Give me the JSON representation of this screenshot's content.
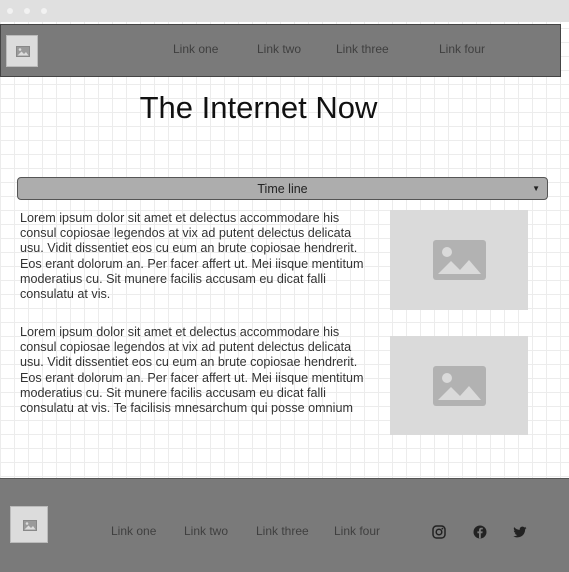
{
  "window": {
    "controls": [
      "close",
      "minimize",
      "maximize"
    ]
  },
  "header": {
    "logo_icon": "image-icon",
    "nav": [
      "Link one",
      "Link two",
      "Link three",
      "Link four"
    ]
  },
  "main": {
    "title": "The Internet Now",
    "dropdown": {
      "selected": "Time line",
      "icon": "caret-down-icon"
    },
    "paragraphs": [
      "Lorem ipsum dolor sit amet et delectus accommodare his consul copiosae legendos at vix ad putent delectus delicata usu. Vidit dissentiet eos cu eum an brute copiosae hendrerit. Eos erant dolorum an. Per facer affert ut. Mei iisque mentitum moderatius cu. Sit munere facilis accusam eu dicat falli consulatu at vis.",
      "Lorem ipsum dolor sit amet et delectus accommodare his consul copiosae legendos at vix ad putent delectus delicata usu. Vidit dissentiet eos cu eum an brute copiosae hendrerit. Eos erant dolorum an. Per facer affert ut. Mei iisque mentitum moderatius cu. Sit munere facilis accusam eu dicat falli consulatu at vis. Te facilisis mnesarchum qui posse omnium"
    ],
    "image_icons": [
      "image-placeholder-icon",
      "image-placeholder-icon"
    ]
  },
  "footer": {
    "logo_icon": "image-icon",
    "nav": [
      "Link one",
      "Link two",
      "Link three",
      "Link four"
    ],
    "social": [
      "instagram-icon",
      "facebook-icon",
      "twitter-icon"
    ]
  },
  "colors": {
    "bar_background": "#7a7a7a",
    "dropdown_background": "#adadad",
    "placeholder_background": "#dadada",
    "grid_line": "#ececec"
  }
}
